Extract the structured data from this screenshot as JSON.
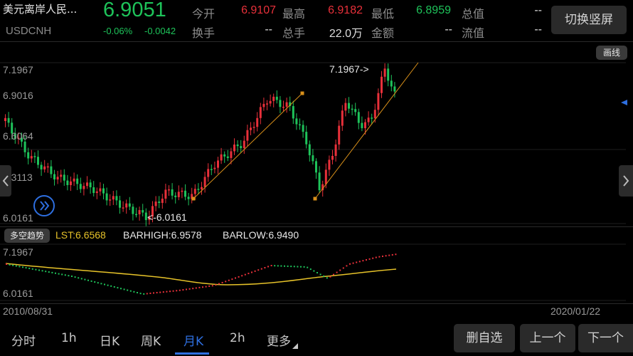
{
  "header": {
    "name": "美元离岸人民...",
    "price": "6.9051",
    "code": "USDCNH",
    "change_pct": "-0.06%",
    "change_abs": "-0.0042",
    "switch_button": "切换竖屏"
  },
  "stats": {
    "open_label": "今开",
    "open_value": "6.9107",
    "high_label": "最高",
    "high_value": "6.9182",
    "low_label": "最低",
    "low_value": "6.8959",
    "total_value_label": "总值",
    "total_value": "--",
    "turnover_label": "换手",
    "turnover_value": "--",
    "volume_label": "总手",
    "volume_value": "22.0万",
    "amount_label": "金额",
    "amount_value": "--",
    "float_label": "流值",
    "float_value": "--"
  },
  "main_chart": {
    "draw_line_button": "画线",
    "y_labels": [
      "7.1967",
      "6.9016",
      "6.6064",
      "6.3113",
      "6.0161"
    ],
    "high_annotation": "7.1967->",
    "low_annotation": "<-6.0161"
  },
  "indicator": {
    "name_button": "多空趋势",
    "lst": "LST:6.6568",
    "barhigh": "BARHIGH:6.9578",
    "barlow": "BARLOW:6.9490",
    "y_top": "7.1967",
    "y_bottom": "6.0161"
  },
  "dates": {
    "start": "2010/08/31",
    "end": "2020/01/22"
  },
  "tabs": [
    {
      "label": "分时"
    },
    {
      "label": "1h"
    },
    {
      "label": "日K"
    },
    {
      "label": "周K"
    },
    {
      "label": "月K"
    },
    {
      "label": "2h"
    },
    {
      "label": "更多"
    }
  ],
  "buttons": {
    "remove_fav": "删自选",
    "prev": "上一个",
    "next": "下一个"
  },
  "colors": {
    "up": "#e8303a",
    "down": "#1ec35a",
    "accent": "#2e6fe0",
    "trend_line": "#d9901a",
    "ma_line": "#e6c229"
  }
}
